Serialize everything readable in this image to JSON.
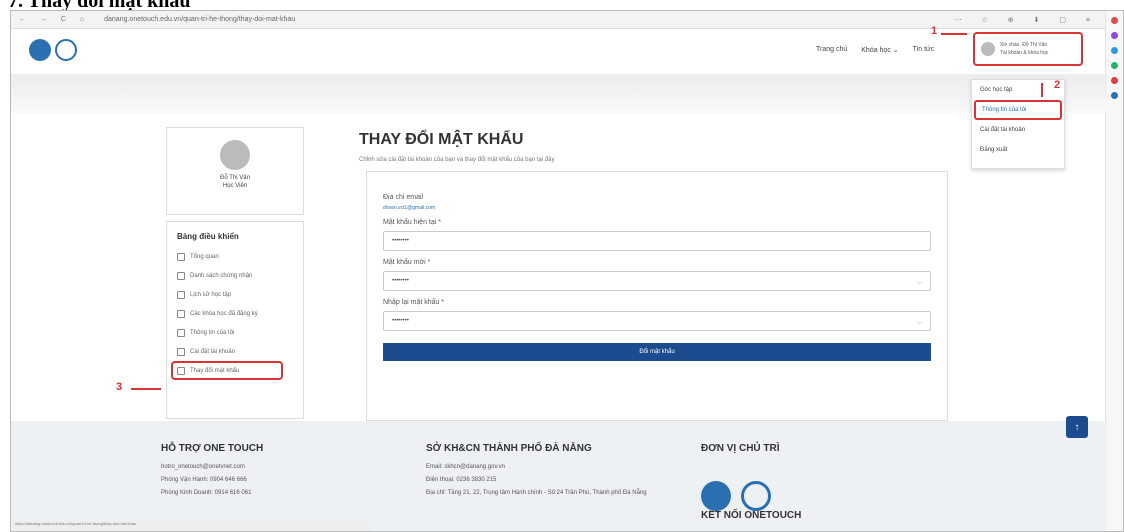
{
  "caption": "7. Thay đổi mật khẩu",
  "browser": {
    "url": "danang.onetouch.edu.vn/quan-tri-he-thong/thay-doi-mat-khau",
    "nav_glyphs": "← → C ⌂",
    "right_glyphs": "⋯ ☆ ⊕ ⬇ ▢ ≡"
  },
  "header": {
    "nav": [
      "Trang chủ",
      "Khóa học ⌄",
      "Tin tức"
    ],
    "user": {
      "line1": "Xin chào, Đỗ Thị Vân",
      "line2": "Tài khoản & khóa học"
    }
  },
  "dropdown": {
    "items": [
      "Góc học tập",
      "Thông tin của tôi",
      "Cài đặt tài khoản",
      "Đăng xuất"
    ]
  },
  "annotations": {
    "one": "1",
    "two": "2",
    "three": "3"
  },
  "profile": {
    "name": "Đỗ Thị Vân",
    "role": "Học Viên"
  },
  "sidebar": {
    "title": "Bảng điều khiển",
    "items": [
      "Tổng quan",
      "Danh sách chứng nhận",
      "Lịch sử học tập",
      "Các khóa học đã đăng ký",
      "Thông tin của tôi",
      "Cài đặt tài khoản",
      "Thay đổi mật khẩu"
    ]
  },
  "page": {
    "title": "THAY ĐỔI MẬT KHẨU",
    "subtitle": "Chỉnh sửa cài đặt tài khoản của bạn và thay đổi mật khẩu của bạn tại đây"
  },
  "form": {
    "email_label": "Địa chỉ email",
    "email_value": "dovan.vct1@gmail.com",
    "current_label": "Mật khẩu hiện tại *",
    "current_value": "••••••••",
    "new_label": "Mật khẩu mới *",
    "new_value": "••••••••",
    "confirm_label": "Nhập lại mật khẩu *",
    "confirm_value": "••••••••",
    "submit": "Đổi mật khẩu"
  },
  "footer": {
    "col1": {
      "title": "HỖ TRỢ ONE TOUCH",
      "lines": [
        "hotro_onetouch@onetvnet.com",
        "Phòng Vận Hành: 0904 646 666",
        "Phòng Kinh Doanh: 0914 616 061"
      ]
    },
    "col2": {
      "title": "SỞ KH&CN THÀNH PHỐ ĐÀ NẴNG",
      "lines": [
        "Email: skhcn@danang.gov.vn",
        "Điện thoại: 0236 3830 215",
        "Địa chỉ: Tầng 21, 22, Trung tâm Hành chính - Số 24 Trần Phú, Thành phố Đà Nẵng"
      ]
    },
    "col3": {
      "title": "ĐƠN VỊ CHỦ TRÌ",
      "extra": "KẾT NỐI ONETOUCH"
    },
    "back_top": "↑"
  },
  "status_text": "https://danang.onetouch.edu.vn/quan-tri-he-thong/thay-doi-mat-khau"
}
